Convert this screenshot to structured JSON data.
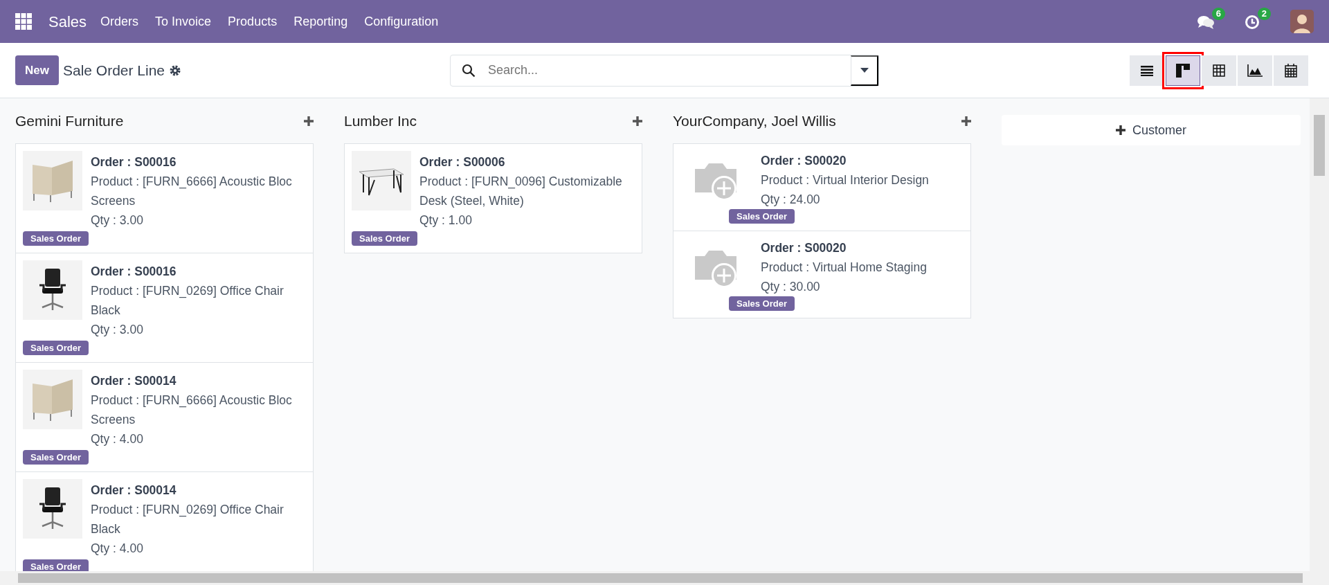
{
  "navbar": {
    "app_name": "Sales",
    "menu": [
      "Orders",
      "To Invoice",
      "Products",
      "Reporting",
      "Configuration"
    ],
    "messages_count": "6",
    "activities_count": "2"
  },
  "control_panel": {
    "new_button": "New",
    "title": "Sale Order Line",
    "search": {
      "placeholder": "Search..."
    },
    "views": [
      {
        "kind": "list",
        "selected": false
      },
      {
        "kind": "kanban",
        "selected": true
      },
      {
        "kind": "pivot",
        "selected": false
      },
      {
        "kind": "graph",
        "selected": false
      },
      {
        "kind": "calendar",
        "selected": false
      }
    ]
  },
  "kanban": {
    "columns": [
      {
        "title": "Gemini Furniture",
        "cards": [
          {
            "order": "Order : S00016",
            "product": "Product : [FURN_6666] Acoustic Bloc Screens",
            "qty": "Qty : 3.00",
            "tag": "Sales Order",
            "kind": "screen"
          },
          {
            "order": "Order : S00016",
            "product": "Product : [FURN_0269] Office Chair Black",
            "qty": "Qty : 3.00",
            "tag": "Sales Order",
            "kind": "chair"
          },
          {
            "order": "Order : S00014",
            "product": "Product : [FURN_6666] Acoustic Bloc Screens",
            "qty": "Qty : 4.00",
            "tag": "Sales Order",
            "kind": "screen"
          },
          {
            "order": "Order : S00014",
            "product": "Product : [FURN_0269] Office Chair Black",
            "qty": "Qty : 4.00",
            "tag": "Sales Order",
            "kind": "chair"
          }
        ]
      },
      {
        "title": "Lumber Inc",
        "cards": [
          {
            "order": "Order : S00006",
            "product": "Product : [FURN_0096] Customizable Desk (Steel, White)",
            "qty": "Qty : 1.00",
            "tag": "Sales Order",
            "kind": "desk"
          }
        ]
      },
      {
        "title": "YourCompany, Joel Willis",
        "cards": [
          {
            "order": "Order : S00020",
            "product": "Product : Virtual Interior Design",
            "qty": "Qty : 24.00",
            "tag": "Sales Order",
            "kind": "placeholder"
          },
          {
            "order": "Order : S00020",
            "product": "Product : Virtual Home Staging",
            "qty": "Qty : 30.00",
            "tag": "Sales Order",
            "kind": "placeholder"
          }
        ]
      }
    ],
    "add_column_button": "Customer"
  }
}
